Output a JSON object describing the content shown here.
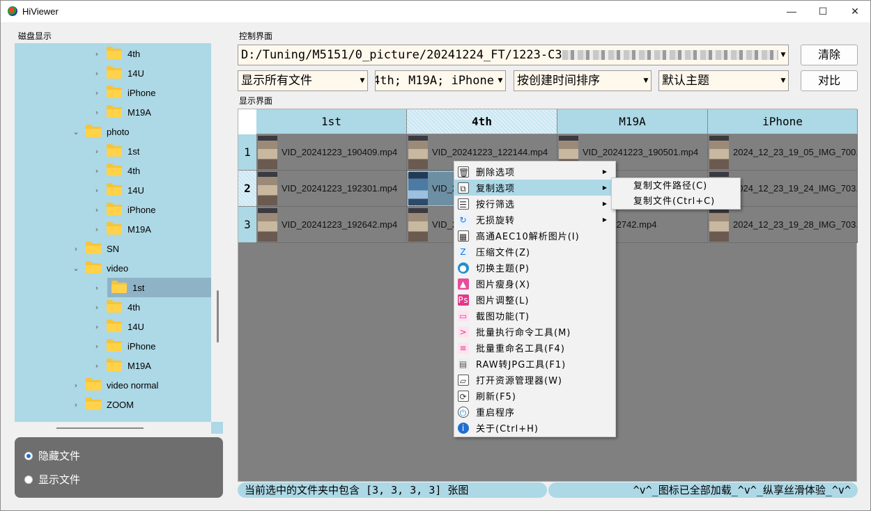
{
  "window": {
    "title": "HiViewer",
    "minimize": "—",
    "maximize": "☐",
    "close": "✕"
  },
  "groups": {
    "disk": "磁盘显示",
    "control": "控制界面",
    "display": "显示界面"
  },
  "tree": [
    {
      "label": "4th",
      "depth": 1
    },
    {
      "label": "14U",
      "depth": 1
    },
    {
      "label": "iPhone",
      "depth": 1
    },
    {
      "label": "M19A",
      "depth": 1
    },
    {
      "label": "photo",
      "depth": 0,
      "expanded": true
    },
    {
      "label": "1st",
      "depth": 1
    },
    {
      "label": "4th",
      "depth": 1
    },
    {
      "label": "14U",
      "depth": 1
    },
    {
      "label": "iPhone",
      "depth": 1
    },
    {
      "label": "M19A",
      "depth": 1
    },
    {
      "label": "SN",
      "depth": 0
    },
    {
      "label": "video",
      "depth": 0,
      "expanded": true
    },
    {
      "label": "1st",
      "depth": 1,
      "selected": true
    },
    {
      "label": "4th",
      "depth": 1
    },
    {
      "label": "14U",
      "depth": 1
    },
    {
      "label": "iPhone",
      "depth": 1
    },
    {
      "label": "M19A",
      "depth": 1
    },
    {
      "label": "video normal",
      "depth": 0
    },
    {
      "label": "ZOOM",
      "depth": 0
    }
  ],
  "radios": {
    "hide": "隐藏文件",
    "show": "显示文件",
    "selected": "hide"
  },
  "path_combo": "D:/Tuning/M5151/0_picture/20241224_FT/1223-C3",
  "filter_combo": "显示所有文件",
  "folders_combo": "4th; M19A; iPhone",
  "sort_combo": "按创建时间排序",
  "theme_combo": "默认主题",
  "buttons": {
    "clear": "清除",
    "compare": "对比"
  },
  "table": {
    "columns": [
      "1st",
      "4th",
      "M19A",
      "iPhone"
    ],
    "rows": [
      {
        "num": "1",
        "cells": [
          "VID_20241223_190409.mp4",
          "VID_20241223_122144.mp4",
          "VID_20241223_190501.mp4",
          "2024_12_23_19_05_IMG_700..."
        ]
      },
      {
        "num": "2",
        "cells": [
          "VID_20241223_192301.mp4",
          "VID_2",
          "",
          "2024_12_23_19_24_IMG_703..."
        ]
      },
      {
        "num": "3",
        "cells": [
          "VID_20241223_192642.mp4",
          "VID_2",
          "1223_192742.mp4",
          "2024_12_23_19_28_IMG_703..."
        ]
      }
    ]
  },
  "status": {
    "left": "当前选中的文件夹中包含 [3, 3, 3, 3] 张图",
    "right": "^v^_图标已全部加载_^v^_纵享丝滑体验_^v^"
  },
  "context_menu": [
    {
      "label": "删除选项",
      "icon": "trash-icon",
      "submenu": true
    },
    {
      "label": "复制选项",
      "icon": "copy-icon",
      "submenu": true,
      "highlighted": true
    },
    {
      "label": "按行筛选",
      "icon": "filter-lines-icon",
      "submenu": true
    },
    {
      "label": "无损旋转",
      "icon": "rotate-icon",
      "submenu": true
    },
    {
      "label": "高通AEC10解析图片(I)",
      "icon": "qrcode-icon"
    },
    {
      "label": "压缩文件(Z)",
      "icon": "zip-icon"
    },
    {
      "label": "切换主题(P)",
      "icon": "palette-icon"
    },
    {
      "label": "图片瘦身(X)",
      "icon": "image-slim-icon"
    },
    {
      "label": "图片调整(L)",
      "icon": "photoshop-icon"
    },
    {
      "label": "截图功能(T)",
      "icon": "screenshot-icon"
    },
    {
      "label": "批量执行命令工具(M)",
      "icon": "terminal-icon"
    },
    {
      "label": "批量重命名工具(F4)",
      "icon": "rename-icon"
    },
    {
      "label": "RAW转JPG工具(F1)",
      "icon": "raw-file-icon"
    },
    {
      "label": "打开资源管理器(W)",
      "icon": "folder-open-icon"
    },
    {
      "label": "刷新(F5)",
      "icon": "refresh-icon"
    },
    {
      "label": "重启程序",
      "icon": "power-icon"
    },
    {
      "label": "关于(Ctrl+H)",
      "icon": "info-icon"
    }
  ],
  "copy_submenu": [
    "复制文件路径(C)",
    "复制文件(Ctrl+C)"
  ],
  "colors": {
    "accent": "#add8e6",
    "menu_highlight": "#add8e6",
    "grid_bg": "#808080"
  }
}
